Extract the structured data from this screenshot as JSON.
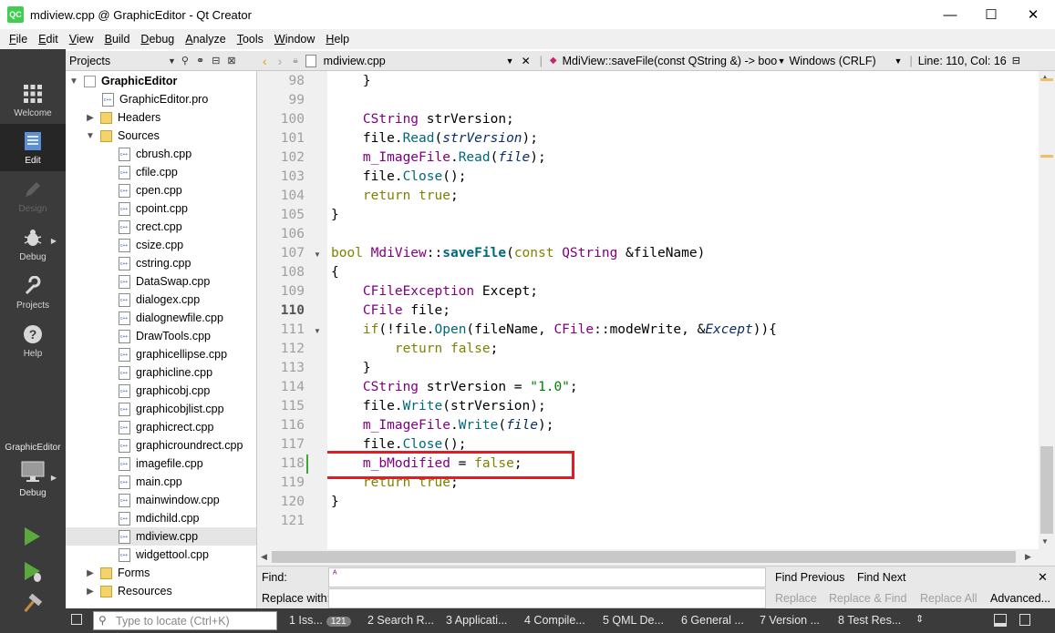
{
  "window": {
    "title": "mdiview.cpp @ GraphicEditor - Qt Creator",
    "logo": "QC",
    "minimize": "—",
    "maximize": "☐",
    "close": "✕"
  },
  "menu": [
    "File",
    "Edit",
    "View",
    "Build",
    "Debug",
    "Analyze",
    "Tools",
    "Window",
    "Help"
  ],
  "modes": {
    "welcome": "Welcome",
    "edit": "Edit",
    "design": "Design",
    "debug": "Debug",
    "projects": "Projects",
    "help": "Help"
  },
  "kit": {
    "project": "GraphicEditor",
    "config": "Debug"
  },
  "projects_pane": {
    "title": "Projects",
    "tree": {
      "root": "GraphicEditor",
      "pro_file": "GraphicEditor.pro",
      "headers": "Headers",
      "sources": "Sources",
      "files": [
        "cbrush.cpp",
        "cfile.cpp",
        "cpen.cpp",
        "cpoint.cpp",
        "crect.cpp",
        "csize.cpp",
        "cstring.cpp",
        "DataSwap.cpp",
        "dialogex.cpp",
        "dialognewfile.cpp",
        "DrawTools.cpp",
        "graphicellipse.cpp",
        "graphicline.cpp",
        "graphicobj.cpp",
        "graphicobjlist.cpp",
        "graphicrect.cpp",
        "graphicroundrect.cpp",
        "imagefile.cpp",
        "main.cpp",
        "mainwindow.cpp",
        "mdichild.cpp",
        "mdiview.cpp",
        "widgettool.cpp"
      ],
      "selected": "mdiview.cpp",
      "forms": "Forms",
      "resources": "Resources"
    }
  },
  "editor": {
    "file": "mdiview.cpp",
    "symbol": "MdiView::saveFile(const QString &) -> bool",
    "line_ending": "Windows (CRLF)",
    "position": "Line: 110, Col: 16",
    "current_line": 110,
    "highlight_line": 118,
    "line_numbers": [
      98,
      99,
      100,
      101,
      102,
      103,
      104,
      105,
      106,
      107,
      108,
      109,
      110,
      111,
      112,
      113,
      114,
      115,
      116,
      117,
      118,
      119,
      120,
      121
    ],
    "code": [
      "    }",
      "",
      "    CString strVersion;",
      "    file.Read(strVersion);",
      "    m_ImageFile.Read(file);",
      "    file.Close();",
      "    return true;",
      "}",
      "",
      "bool MdiView::saveFile(const QString &fileName)",
      "{",
      "    CFileException Except;",
      "    CFile file;",
      "    if(!file.Open(fileName, CFile::modeWrite, &Except)){",
      "        return false;",
      "    }",
      "    CString strVersion = \"1.0\";",
      "    file.Write(strVersion);",
      "    m_ImageFile.Write(file);",
      "    file.Close();",
      "    m_bModified = false;",
      "    return true;",
      "}",
      ""
    ]
  },
  "find": {
    "find_label": "Find:",
    "replace_label": "Replace with:",
    "find_previous": "Find Previous",
    "find_next": "Find Next",
    "replace": "Replace",
    "replace_find": "Replace & Find",
    "replace_all": "Replace All",
    "advanced": "Advanced..."
  },
  "statusbar": {
    "locate_placeholder": "Type to locate (Ctrl+K)",
    "tabs": [
      "1  Iss...",
      "2  Search R...",
      "3  Applicati...",
      "4  Compile...",
      "5  QML De...",
      "6  General ...",
      "7  Version ...",
      "8  Test Res..."
    ],
    "issues_count": "121"
  },
  "colors": {
    "highlight_box": "#e31b23",
    "sidebar": "#3b3b3b",
    "run": "#5aa83e"
  }
}
